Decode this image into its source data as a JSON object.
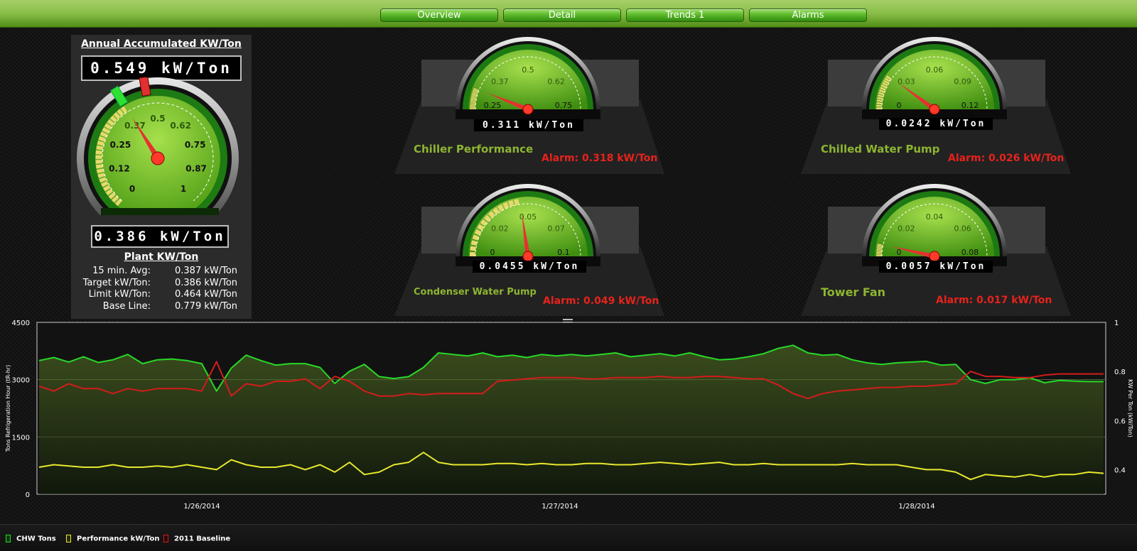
{
  "nav": {
    "tabs": [
      {
        "label": "Overview"
      },
      {
        "label": "Detail"
      },
      {
        "label": "Trends 1"
      },
      {
        "label": "Alarms"
      }
    ]
  },
  "main_gauge": {
    "title": "Annual Accumulated KW/Ton",
    "top_reading": "0.549 kW/Ton",
    "bottom_reading": "0.386 kW/Ton",
    "ticks": [
      "0",
      "0.12",
      "0.25",
      "0.37",
      "0.5",
      "0.62",
      "0.75",
      "0.87",
      "1"
    ],
    "scale_max": 1,
    "needle_value": 0.386,
    "green_marker_value": 0.386,
    "red_marker_value": 0.464,
    "colors": {
      "face": "#7cc230",
      "needle": "#e83030"
    }
  },
  "plant": {
    "title": "Plant KW/Ton",
    "rows": [
      {
        "label": "15 min. Avg:",
        "value": "0.387 kW/Ton"
      },
      {
        "label": "Target kW/Ton:",
        "value": "0.386 kW/Ton"
      },
      {
        "label": "Limit kW/Ton:",
        "value": "0.464 kW/Ton"
      },
      {
        "label": "Base Line:",
        "value": "0.779 kW/Ton"
      }
    ]
  },
  "gauges": [
    {
      "title": "Chiller Performance",
      "alarm": "Alarm: 0.318 kW/Ton",
      "reading": "0.311 kW/Ton",
      "ticks": [
        "0.25",
        "0.37",
        "0.5",
        "0.62",
        "0.75"
      ],
      "min": 0.25,
      "max": 0.75,
      "value": 0.311
    },
    {
      "title": "Chilled Water Pump",
      "alarm": "Alarm: 0.026 kW/Ton",
      "reading": "0.0242 kW/Ton",
      "ticks": [
        "0",
        "0.03",
        "0.06",
        "0.09",
        "0.12"
      ],
      "min": 0,
      "max": 0.12,
      "value": 0.0242
    },
    {
      "title": "Condenser Water Pump",
      "alarm": "Alarm: 0.049 kW/Ton",
      "reading": "0.0455 kW/Ton",
      "ticks": [
        "0",
        "0.02",
        "0.05",
        "0.07",
        "0.1"
      ],
      "min": 0,
      "max": 0.1,
      "value": 0.0455
    },
    {
      "title": "Tower Fan",
      "alarm": "Alarm: 0.017 kW/Ton",
      "reading": "0.0057 kW/Ton",
      "ticks": [
        "0",
        "0.02",
        "0.04",
        "0.06",
        "0.08"
      ],
      "min": 0,
      "max": 0.08,
      "value": 0.0057
    }
  ],
  "chart_data": {
    "type": "line",
    "title": "",
    "ylabel": "Tons Refrigeration Hour (tR-hr)",
    "ylabel_right": "KW Per Ton (kW/Ton)",
    "ylim": [
      0,
      4500
    ],
    "ylim_right": [
      0.3,
      1
    ],
    "y_ticks": [
      "0",
      "1500",
      "3000",
      "4500"
    ],
    "y_ticks_right": [
      "0.4",
      "0.6",
      "0.8",
      "1"
    ],
    "x_labels": [
      "1/26/2014",
      "1/27/2014",
      "1/28/2014"
    ],
    "grid": true,
    "legend_position": "bottom-left",
    "series": [
      {
        "name": "CHW Tons",
        "axis": "left",
        "color": "#28d828",
        "values": [
          3500,
          3580,
          3460,
          3600,
          3450,
          3520,
          3660,
          3420,
          3520,
          3540,
          3500,
          3420,
          2700,
          3300,
          3640,
          3500,
          3380,
          3420,
          3420,
          3320,
          2900,
          3220,
          3400,
          3080,
          3030,
          3080,
          3320,
          3700,
          3660,
          3620,
          3700,
          3600,
          3640,
          3580,
          3660,
          3620,
          3660,
          3620,
          3660,
          3700,
          3600,
          3640,
          3680,
          3620,
          3700,
          3600,
          3520,
          3540,
          3600,
          3680,
          3820,
          3900,
          3700,
          3640,
          3660,
          3520,
          3440,
          3400,
          3440,
          3460,
          3480,
          3380,
          3400,
          3000,
          2900,
          3000,
          3000,
          3050,
          2920,
          2980,
          2960,
          2950,
          2950
        ]
      },
      {
        "name": "Performance kW/Ton",
        "axis": "right",
        "color": "#e8e82e",
        "values": [
          0.41,
          0.42,
          0.415,
          0.41,
          0.41,
          0.42,
          0.41,
          0.41,
          0.415,
          0.41,
          0.42,
          0.41,
          0.4,
          0.44,
          0.42,
          0.41,
          0.41,
          0.42,
          0.4,
          0.42,
          0.39,
          0.43,
          0.38,
          0.39,
          0.42,
          0.43,
          0.47,
          0.43,
          0.42,
          0.42,
          0.42,
          0.425,
          0.425,
          0.42,
          0.425,
          0.42,
          0.42,
          0.425,
          0.425,
          0.42,
          0.42,
          0.425,
          0.43,
          0.425,
          0.42,
          0.425,
          0.43,
          0.42,
          0.42,
          0.425,
          0.42,
          0.42,
          0.42,
          0.42,
          0.42,
          0.425,
          0.42,
          0.42,
          0.42,
          0.41,
          0.4,
          0.4,
          0.39,
          0.36,
          0.38,
          0.375,
          0.37,
          0.38,
          0.37,
          0.38,
          0.38,
          0.39,
          0.385
        ]
      },
      {
        "name": "2011 Baseline",
        "axis": "right",
        "color": "#d41c1c",
        "values": [
          0.74,
          0.72,
          0.75,
          0.73,
          0.73,
          0.71,
          0.73,
          0.72,
          0.73,
          0.73,
          0.73,
          0.72,
          0.84,
          0.7,
          0.75,
          0.74,
          0.76,
          0.76,
          0.77,
          0.73,
          0.78,
          0.76,
          0.72,
          0.7,
          0.7,
          0.71,
          0.705,
          0.71,
          0.71,
          0.71,
          0.71,
          0.76,
          0.765,
          0.77,
          0.775,
          0.775,
          0.775,
          0.77,
          0.77,
          0.775,
          0.775,
          0.775,
          0.78,
          0.775,
          0.775,
          0.78,
          0.78,
          0.775,
          0.77,
          0.77,
          0.745,
          0.71,
          0.69,
          0.71,
          0.72,
          0.725,
          0.73,
          0.735,
          0.735,
          0.74,
          0.74,
          0.745,
          0.75,
          0.8,
          0.78,
          0.78,
          0.775,
          0.775,
          0.785,
          0.79,
          0.79,
          0.79,
          0.79
        ]
      }
    ]
  },
  "legend": [
    {
      "label": "CHW Tons",
      "color": "#28d828"
    },
    {
      "label": "Performance kW/Ton",
      "color": "#e8e82e"
    },
    {
      "label": "2011 Baseline",
      "color": "#d41c1c"
    }
  ]
}
